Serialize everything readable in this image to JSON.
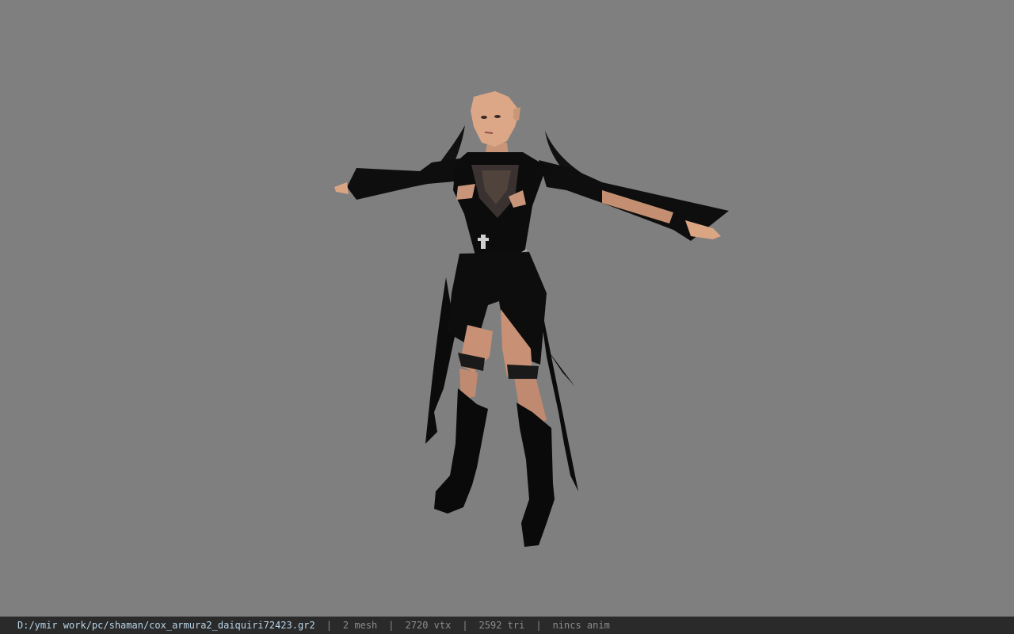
{
  "viewport": {
    "background_color": "#7f7f7f",
    "model_icon": "character-model-icon"
  },
  "statusbar": {
    "file_path": "D:/ymir work/pc/shaman/cox_armura2_daiquiri72423.gr2",
    "separator": "|",
    "mesh_count": "2 mesh",
    "vertex_count": "2720 vtx",
    "triangle_count": "2592 tri",
    "anim_status": "nincs anim"
  },
  "colors": {
    "skin": "#d9a583",
    "armor": "#0d0d0d",
    "armor_highlight": "#3a3230",
    "statusbar_bg": "#2a2a2a",
    "path_text": "#b9d6ea"
  }
}
